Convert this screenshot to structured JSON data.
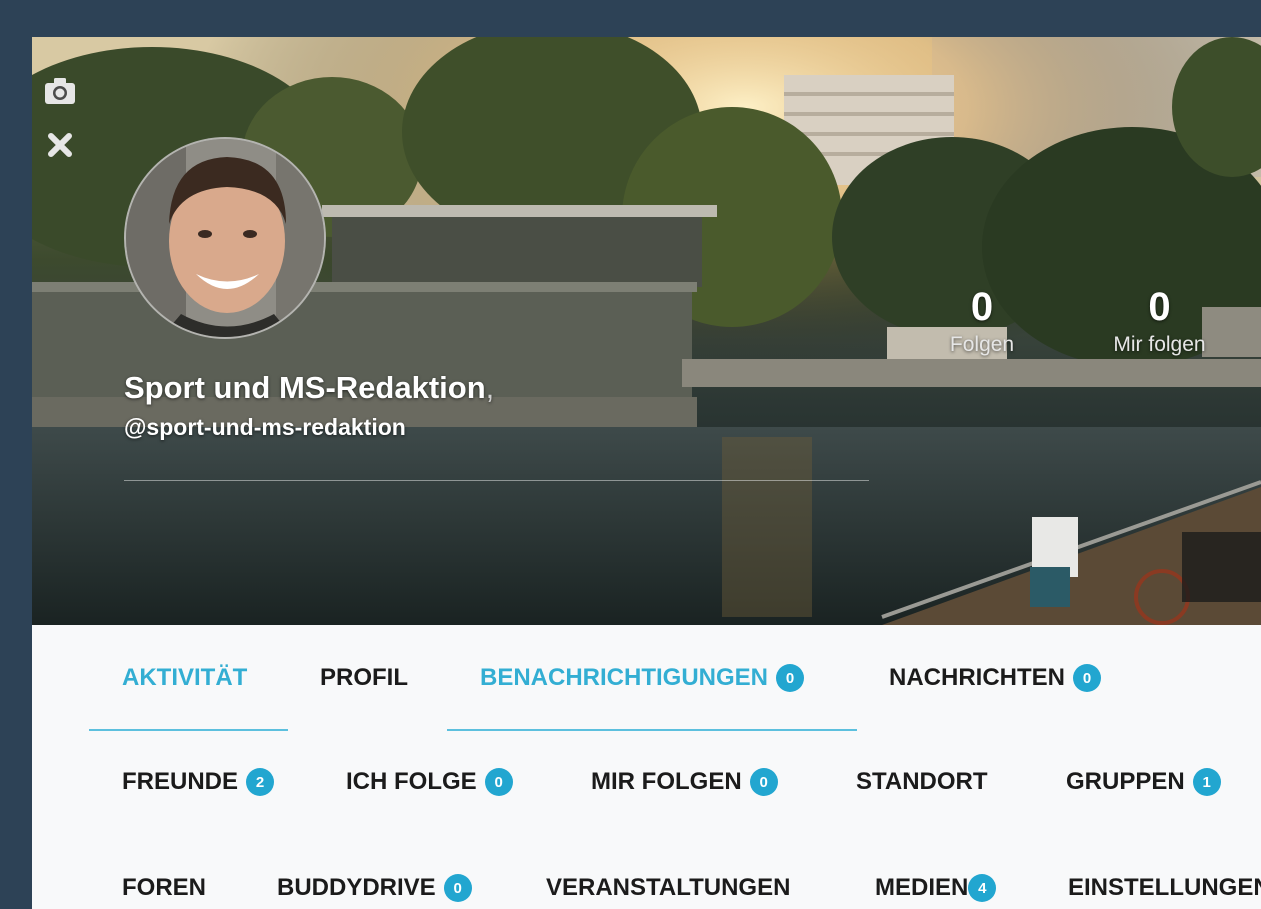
{
  "cover": {
    "camera_icon": "camera-icon",
    "close_icon": "close-icon"
  },
  "profile": {
    "display_name": "Sport und MS-Redaktion",
    "name_suffix": ",",
    "handle": "@sport-und-ms-redaktion"
  },
  "stats": [
    {
      "count": "0",
      "label": "Folgen"
    },
    {
      "count": "0",
      "label": "Mir folgen"
    }
  ],
  "nav": {
    "row1": [
      {
        "label": "AKTIVITÄT",
        "badge": null
      },
      {
        "label": "PROFIL",
        "badge": null
      },
      {
        "label": "BENACHRICHTIGUNGEN",
        "badge": "0"
      },
      {
        "label": "NACHRICHTEN",
        "badge": "0"
      }
    ],
    "row2": [
      {
        "label": "FREUNDE",
        "badge": "2"
      },
      {
        "label": "ICH FOLGE",
        "badge": "0"
      },
      {
        "label": "MIR FOLGEN",
        "badge": "0"
      },
      {
        "label": "STANDORT",
        "badge": null
      },
      {
        "label": "GRUPPEN",
        "badge": "1"
      }
    ],
    "row3": [
      {
        "label": "FOREN",
        "badge": null
      },
      {
        "label": "BUDDYDRIVE",
        "badge": "0"
      },
      {
        "label": "VERANSTALTUNGEN",
        "badge": null
      },
      {
        "label": "MEDIEN",
        "badge": "4"
      },
      {
        "label": "EINSTELLUNGEN",
        "badge": null
      }
    ]
  },
  "colors": {
    "page_background": "#2d4256",
    "accent": "#33aed3",
    "badge": "#22a6d0"
  }
}
